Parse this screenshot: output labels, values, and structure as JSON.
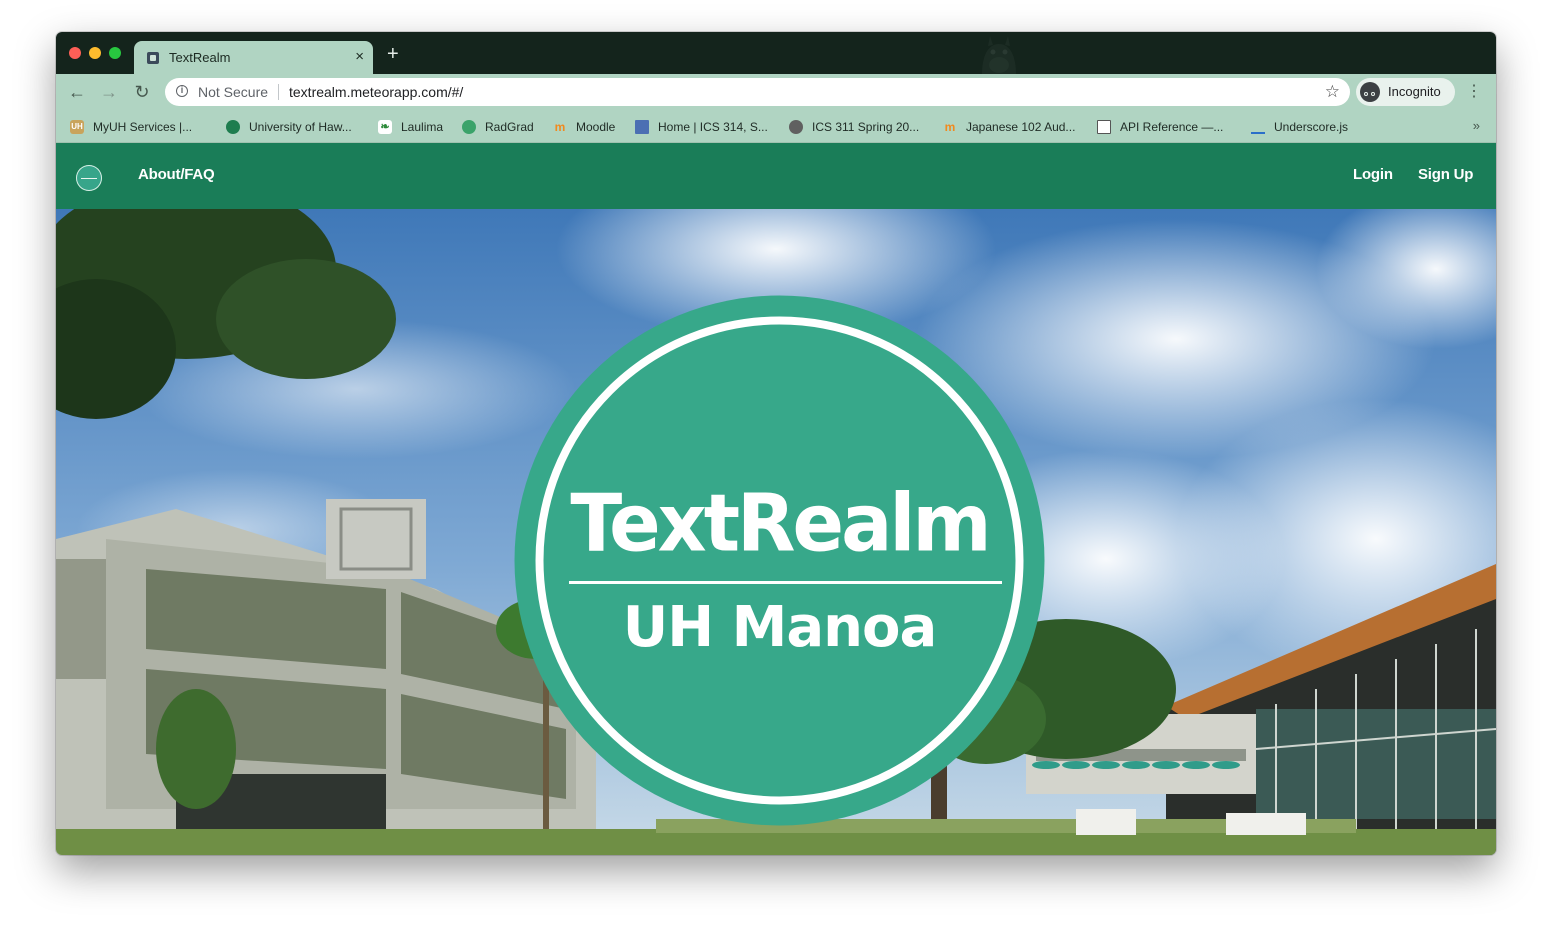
{
  "browser": {
    "tab": {
      "title": "TextRealm",
      "close_glyph": "×"
    },
    "new_tab_glyph": "+",
    "address_bar": {
      "security_label": "Not Secure",
      "url": "textrealm.meteorapp.com/#/"
    },
    "profile_label": "Incognito",
    "bookmarks": [
      {
        "label": "MyUH Services |...",
        "icon": "uh-icon",
        "color": "#c9a45c"
      },
      {
        "label": "University of Haw...",
        "icon": "uh-seal-icon",
        "color": "#1e7d4f"
      },
      {
        "label": "Laulima",
        "icon": "leaf-icon",
        "color": "#2e8b3a"
      },
      {
        "label": "RadGrad",
        "icon": "radgrad-icon",
        "color": "#3aa36a"
      },
      {
        "label": "Moodle",
        "icon": "moodle-icon",
        "color": "#f18a1e"
      },
      {
        "label": "Home | ICS 314, S...",
        "icon": "square-icon",
        "color": "#4b6fb3"
      },
      {
        "label": "ICS 311 Spring 20...",
        "icon": "circle-icon",
        "color": "#606060"
      },
      {
        "label": "Japanese 102 Aud...",
        "icon": "moodle-icon",
        "color": "#f18a1e"
      },
      {
        "label": "API Reference —...",
        "icon": "doc-icon",
        "color": "#555555"
      },
      {
        "label": "Underscore.js",
        "icon": "underscore-icon",
        "color": "#2a6fc9"
      }
    ],
    "bookmarks_more_glyph": "»"
  },
  "page": {
    "nav": {
      "about_label": "About/FAQ",
      "login_label": "Login",
      "signup_label": "Sign Up"
    },
    "hero": {
      "logo_title": "TextRealm",
      "logo_subtitle": "UH Manoa"
    }
  },
  "colors": {
    "tab_strip": "#14241c",
    "chrome": "#b0d4c2",
    "navbar": "#1a7d58",
    "logo_green": "#37a88a"
  }
}
